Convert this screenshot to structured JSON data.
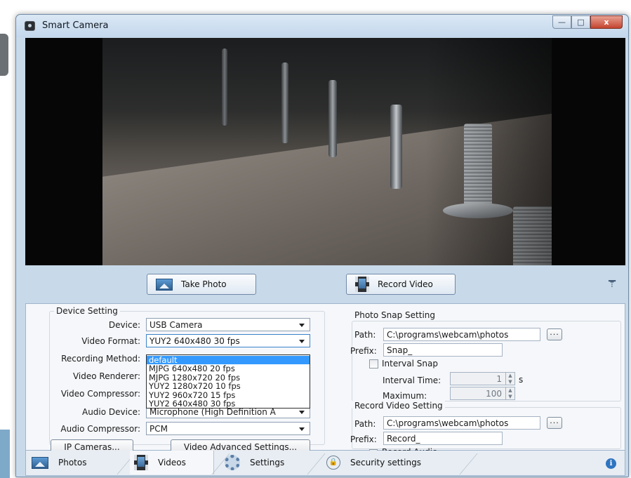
{
  "window": {
    "title": "Smart Camera",
    "controls": {
      "minimize": "—",
      "maximize": "□",
      "close": "x"
    }
  },
  "actions": {
    "take_photo": "Take Photo",
    "record_video": "Record Video",
    "collapse_icon": "collapse-icon"
  },
  "device_setting": {
    "title": "Device Setting",
    "device_label": "Device:",
    "device_value": "USB Camera",
    "video_format_label": "Video Format:",
    "video_format_value": "YUY2 640x480 30 fps",
    "video_format_options": [
      "default",
      "MJPG 640x480 20 fps",
      "MJPG 1280x720 20 fps",
      "YUY2 1280x720 10 fps",
      "YUY2 960x720 15 fps",
      "YUY2 640x480 30 fps"
    ],
    "video_format_selected_index": 0,
    "recording_method_label": "Recording Method:",
    "video_renderer_label": "Video Renderer:",
    "video_compressor_label": "Video Compressor:",
    "audio_device_label": "Audio Device:",
    "audio_device_value": "Microphone (High Definition A",
    "audio_compressor_label": "Audio Compressor:",
    "audio_compressor_value": "PCM",
    "ip_cameras_button": "IP Cameras...",
    "advanced_button": "Video Advanced Settings..."
  },
  "photo_snap": {
    "title": "Photo Snap Setting",
    "path_label": "Path:",
    "path_value": "C:\\programs\\webcam\\photos",
    "browse_label": "...",
    "prefix_label": "Prefix:",
    "prefix_value": "Snap_",
    "interval_snap_label": "Interval Snap",
    "interval_snap_checked": false,
    "interval_time_label": "Interval Time:",
    "interval_time_value": "1",
    "interval_time_unit": "s",
    "maximum_label": "Maximum:",
    "maximum_value": "100"
  },
  "record_video": {
    "title": "Record Video Setting",
    "path_label": "Path:",
    "path_value": "C:\\programs\\webcam\\photos",
    "browse_label": "...",
    "prefix_label": "Prefix:",
    "prefix_value": "Record_",
    "record_audio_label": "Record Audio",
    "record_audio_checked": false
  },
  "tabs": [
    {
      "label": "Photos",
      "icon": "photo-icon",
      "active": false
    },
    {
      "label": "Videos",
      "icon": "film-icon",
      "active": true
    },
    {
      "label": "Settings",
      "icon": "gear-icon",
      "active": false
    },
    {
      "label": "Security settings",
      "icon": "lock-icon",
      "active": false
    }
  ],
  "info_glyph": "i",
  "lock_glyph": "🔒"
}
